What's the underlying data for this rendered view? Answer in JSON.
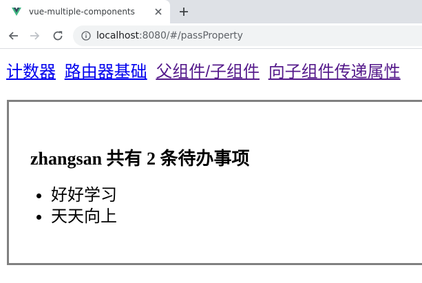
{
  "browser": {
    "tab": {
      "title": "vue-multiple-components"
    },
    "address": {
      "host": "localhost",
      "path": ":8080/#/passProperty"
    },
    "icons": {
      "favicon": "vue-logo-icon",
      "close": "close-icon",
      "new_tab": "plus-icon",
      "back": "arrow-left-icon",
      "forward": "arrow-right-icon",
      "reload": "reload-icon",
      "site_info": "info-icon"
    }
  },
  "page": {
    "nav_links": [
      {
        "label": "计数器",
        "visited": false
      },
      {
        "label": "路由器基础",
        "visited": false
      },
      {
        "label": "父组件/子组件",
        "visited": true
      },
      {
        "label": "向子组件传递属性",
        "visited": true
      }
    ],
    "heading": "zhangsan 共有 2 条待办事项",
    "todos": [
      "好好学习",
      "天天向上"
    ]
  },
  "colors": {
    "link": "#0000ee",
    "visited_link": "#551a8b",
    "panel_border": "#808080",
    "vue_green": "#41b883",
    "vue_dark": "#35495e"
  }
}
